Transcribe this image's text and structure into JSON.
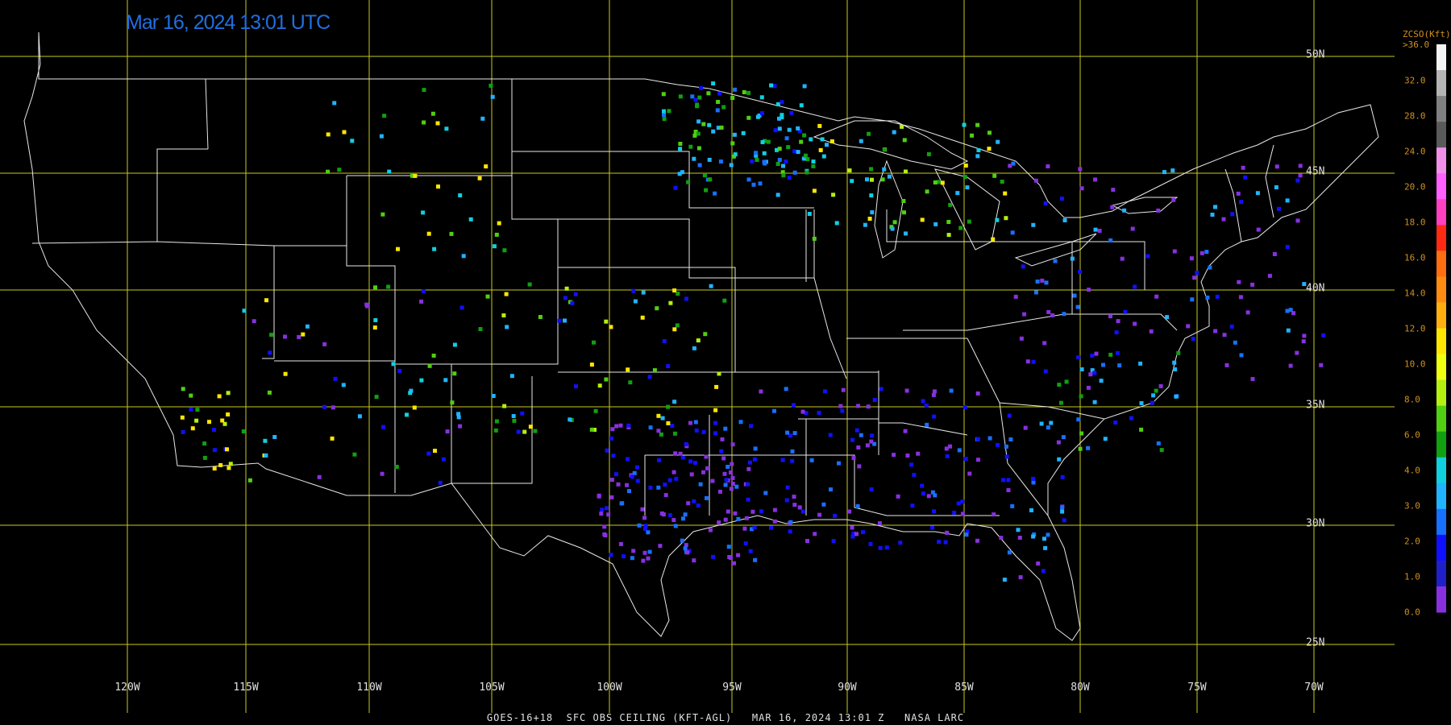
{
  "timestamp": "Mar 16, 2024 13:01 UTC",
  "footer": "GOES-16+18  SFC OBS CEILING (KFT-AGL)   MAR 16, 2024 13:01 Z   NASA LARC",
  "legend": {
    "title": "ZCSO(Kft)",
    "max_label": ">36.0",
    "ticks": [
      "32.0",
      "28.0",
      "24.0",
      "20.0",
      "18.0",
      "16.0",
      "14.0",
      "12.0",
      "10.0",
      "8.0",
      "6.0",
      "4.0",
      "3.0",
      "2.0",
      "1.0",
      "0.0"
    ],
    "colors": [
      "#f4f4f4",
      "#b4b4b4",
      "#808080",
      "#5a5a5a",
      "#f090e8",
      "#ff60ff",
      "#ff40c0",
      "#ff2a14",
      "#ff6e10",
      "#ff8c10",
      "#ffb010",
      "#ffe600",
      "#f0ff10",
      "#b4f010",
      "#50d010",
      "#10a010",
      "#10d0e0",
      "#20b4ff",
      "#1870ff",
      "#1010ff",
      "#2020c8",
      "#8830e0"
    ]
  },
  "grid": {
    "color": "#c8c820",
    "longitudes": [
      "120W",
      "115W",
      "110W",
      "105W",
      "100W",
      "95W",
      "90W",
      "85W",
      "80W",
      "75W",
      "70W"
    ],
    "latitudes": [
      "50N",
      "45N",
      "40N",
      "35N",
      "30N",
      "25N"
    ]
  },
  "observations": {
    "colors": [
      "#8830e0",
      "#1010ff",
      "#1870ff",
      "#20b4ff",
      "#10d0e0",
      "#10a010",
      "#50d010",
      "#b4f010",
      "#ffe600",
      "#ff8c10",
      "#ff2a14",
      "#f090e8",
      "#808080"
    ]
  }
}
